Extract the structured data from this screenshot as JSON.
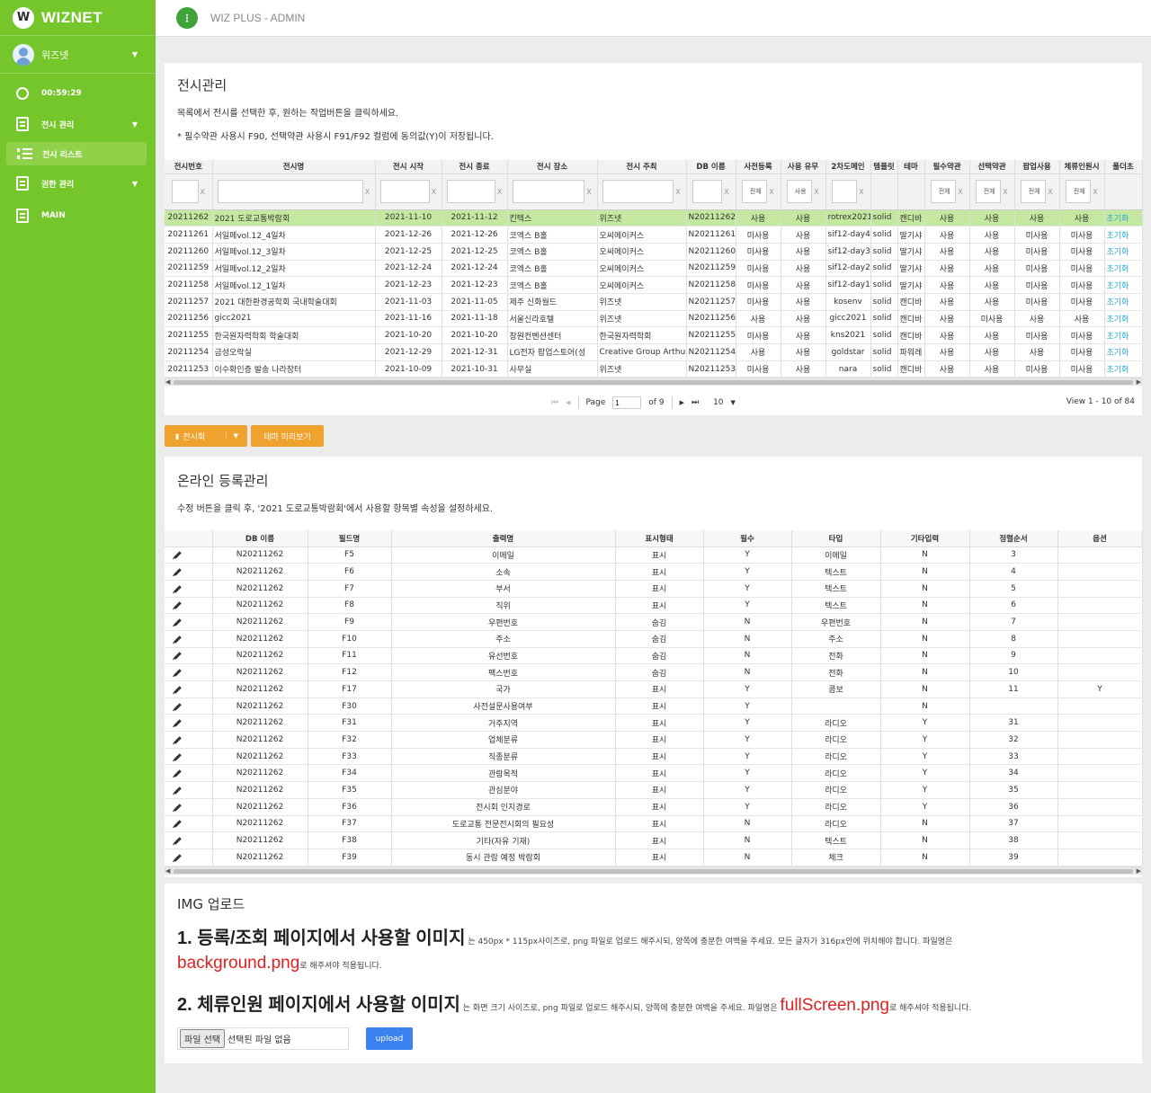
{
  "sidebar": {
    "logo_mark": "W",
    "brand": "WIZNET",
    "user": "위즈넷",
    "timer": "00:59:29",
    "menu1": "전시 관리",
    "submenu1": "전시 리스트",
    "menu2": "권한 관리",
    "menu3": "MAIN"
  },
  "topbar": {
    "menu_icon": "⋮",
    "title": "WIZ PLUS - ADMIN"
  },
  "exhibition": {
    "title": "전시관리",
    "desc1": "목록에서 전시를 선택한 후, 원하는 작업버튼을 클릭하세요.",
    "desc2": "* 필수약관 사용시 F90, 선택약관 사용시 F91/F92 컬럼에 동의값(Y)이 저장됩니다.",
    "columns": [
      "전시번호",
      "전시명",
      "전시 시작",
      "전시 종료",
      "전시 장소",
      "전시 주최",
      "DB 이름",
      "사전등록",
      "사용 유무",
      "2차도메인",
      "템플릿",
      "테마",
      "필수약관",
      "선택약관",
      "팝업사용",
      "체류인원시",
      "폴더초"
    ],
    "filter_clear": "X",
    "filter_selects": {
      "prereg": "전체",
      "use": "사용",
      "req": "전체",
      "opt": "전체",
      "popup": "전체",
      "stay": "전체"
    },
    "rows": [
      [
        "20211262",
        "2021 도로교통박람회",
        "2021-11-10",
        "2021-11-12",
        "킨텍스",
        "위즈넷",
        "N20211262",
        "사용",
        "사용",
        "rotrex2021",
        "solid",
        "캔디바",
        "사용",
        "사용",
        "사용",
        "사용",
        "초기화"
      ],
      [
        "20211261",
        "서일페vol.12_4일차",
        "2021-12-26",
        "2021-12-26",
        "코엑스 B홀",
        "오씨메이커스",
        "N20211261",
        "미사용",
        "사용",
        "sif12-day4",
        "solid",
        "딸기샤",
        "사용",
        "사용",
        "미사용",
        "미사용",
        "초기화"
      ],
      [
        "20211260",
        "서일페vol.12_3일차",
        "2021-12-25",
        "2021-12-25",
        "코엑스 B홀",
        "오씨메이커스",
        "N20211260",
        "미사용",
        "사용",
        "sif12-day3",
        "solid",
        "딸기샤",
        "사용",
        "사용",
        "미사용",
        "미사용",
        "초기화"
      ],
      [
        "20211259",
        "서일페vol.12_2일차",
        "2021-12-24",
        "2021-12-24",
        "코엑스 B홀",
        "오씨메이커스",
        "N20211259",
        "미사용",
        "사용",
        "sif12-day2",
        "solid",
        "딸기샤",
        "사용",
        "사용",
        "미사용",
        "미사용",
        "초기화"
      ],
      [
        "20211258",
        "서일페vol.12_1일차",
        "2021-12-23",
        "2021-12-23",
        "코엑스 B홀",
        "오씨메이커스",
        "N20211258",
        "미사용",
        "사용",
        "sif12-day1",
        "solid",
        "딸기샤",
        "사용",
        "사용",
        "미사용",
        "미사용",
        "초기화"
      ],
      [
        "20211257",
        "2021 대한환경공학회 국내학술대회",
        "2021-11-03",
        "2021-11-05",
        "제주 신화월드",
        "위즈넷",
        "N20211257",
        "미사용",
        "사용",
        "kosenv",
        "solid",
        "캔디바",
        "사용",
        "사용",
        "미사용",
        "미사용",
        "초기화"
      ],
      [
        "20211256",
        "gicc2021",
        "2021-11-16",
        "2021-11-18",
        "서울신라호텔",
        "위즈넷",
        "N20211256",
        "사용",
        "사용",
        "gicc2021",
        "solid",
        "캔디바",
        "사용",
        "미사용",
        "사용",
        "사용",
        "초기화"
      ],
      [
        "20211255",
        "한국원자력학회 학술대회",
        "2021-10-20",
        "2021-10-20",
        "창원컨벤션센터",
        "한국원자력학회",
        "N20211255",
        "미사용",
        "사용",
        "kns2021",
        "solid",
        "캔디바",
        "사용",
        "사용",
        "미사용",
        "미사용",
        "초기화"
      ],
      [
        "20211254",
        "금성오락실",
        "2021-12-29",
        "2021-12-31",
        "LG전자 팝업스토어(성",
        "Creative Group Arthur",
        "N20211254",
        "사용",
        "사용",
        "goldstar",
        "solid",
        "파워레",
        "사용",
        "사용",
        "사용",
        "미사용",
        "초기화"
      ],
      [
        "20211253",
        "이수확인증 발송 나라장터",
        "2021-10-09",
        "2021-10-31",
        "사무실",
        "위즈넷",
        "N20211253",
        "미사용",
        "사용",
        "nara",
        "solid",
        "캔디바",
        "사용",
        "사용",
        "미사용",
        "미사용",
        "초기화"
      ]
    ],
    "pager": {
      "first": "⏮",
      "prev": "◀",
      "page_label": "Page",
      "page": "1",
      "of": "of 9",
      "next": "▶",
      "last": "⏭",
      "size": "10",
      "view": "View 1 - 10 of 84"
    }
  },
  "buttons": {
    "exhibition": "전시회",
    "theme_preview": "테마 미리보기"
  },
  "registration": {
    "title": "온라인 등록관리",
    "desc": "수정 버튼을 클릭 후, '2021 도로교통박람회'에서 사용할 항목별 속성을 설정하세요.",
    "columns": [
      "",
      "DB 이름",
      "필드명",
      "출력명",
      "표시형태",
      "필수",
      "타입",
      "기타입력",
      "정렬순서",
      "옵션"
    ],
    "rows": [
      [
        "N20211262",
        "F5",
        "이메일",
        "표시",
        "Y",
        "이메일",
        "N",
        "3",
        ""
      ],
      [
        "N20211262",
        "F6",
        "소속",
        "표시",
        "Y",
        "텍스트",
        "N",
        "4",
        ""
      ],
      [
        "N20211262",
        "F7",
        "부서",
        "표시",
        "Y",
        "텍스트",
        "N",
        "5",
        ""
      ],
      [
        "N20211262",
        "F8",
        "직위",
        "표시",
        "Y",
        "텍스트",
        "N",
        "6",
        ""
      ],
      [
        "N20211262",
        "F9",
        "우편번호",
        "숨김",
        "N",
        "우편번호",
        "N",
        "7",
        ""
      ],
      [
        "N20211262",
        "F10",
        "주소",
        "숨김",
        "N",
        "주소",
        "N",
        "8",
        ""
      ],
      [
        "N20211262",
        "F11",
        "유선번호",
        "숨김",
        "N",
        "전화",
        "N",
        "9",
        ""
      ],
      [
        "N20211262",
        "F12",
        "팩스번호",
        "숨김",
        "N",
        "전화",
        "N",
        "10",
        ""
      ],
      [
        "N20211262",
        "F17",
        "국가",
        "표시",
        "Y",
        "콤보",
        "N",
        "11",
        "Y"
      ],
      [
        "N20211262",
        "F30",
        "사전설문사용여부",
        "표시",
        "Y",
        "",
        "N",
        "",
        ""
      ],
      [
        "N20211262",
        "F31",
        "거주지역",
        "표시",
        "Y",
        "라디오",
        "Y",
        "31",
        ""
      ],
      [
        "N20211262",
        "F32",
        "업체분류",
        "표시",
        "Y",
        "라디오",
        "Y",
        "32",
        ""
      ],
      [
        "N20211262",
        "F33",
        "직종분류",
        "표시",
        "Y",
        "라디오",
        "Y",
        "33",
        ""
      ],
      [
        "N20211262",
        "F34",
        "관람목적",
        "표시",
        "Y",
        "라디오",
        "Y",
        "34",
        ""
      ],
      [
        "N20211262",
        "F35",
        "관심분야",
        "표시",
        "Y",
        "라디오",
        "Y",
        "35",
        ""
      ],
      [
        "N20211262",
        "F36",
        "전시회 인지경로",
        "표시",
        "Y",
        "라디오",
        "Y",
        "36",
        ""
      ],
      [
        "N20211262",
        "F37",
        "도로교통 전문전시회의 필요성",
        "표시",
        "N",
        "라디오",
        "N",
        "37",
        ""
      ],
      [
        "N20211262",
        "F38",
        "기타(자유 기재)",
        "표시",
        "N",
        "텍스트",
        "N",
        "38",
        ""
      ],
      [
        "N20211262",
        "F39",
        "동시 관람 예정 박람회",
        "표시",
        "N",
        "체크",
        "N",
        "39",
        ""
      ]
    ]
  },
  "img_upload": {
    "title": "IMG 업로드",
    "l1_big": "1. 등록/조회 페이지에서 사용할 이미지",
    "l1_small": " 는 450px * 115px사이즈로, png 파일로 업로드 해주시되, 양쪽에 충분한 여백을 주세요. 모든 글자가 316px안에 위치해야 합니다. 파일명은",
    "l1_red": "background.png",
    "l1_tail": "로 해주셔야 적용됩니다.",
    "l2_big": "2. 체류인원 페이지에서 사용할 이미지",
    "l2_small": " 는 화면 크기 사이즈로, png 파일로 업로드 해주시되, 양쪽에 충분한 여백을 주세요. 파일명은 ",
    "l2_red": "fullScreen.png",
    "l2_tail": "로 해주셔야 적용됩니다.",
    "file_btn": "파일 선택",
    "file_none": "선택된 파일 없음",
    "upload": "upload"
  },
  "colors": {
    "sidebar": "#74c62a",
    "accent": "#f0a22e",
    "selected_row": "#c5e8a0",
    "link": "#2aa9d4",
    "upload": "#3a82f0"
  }
}
